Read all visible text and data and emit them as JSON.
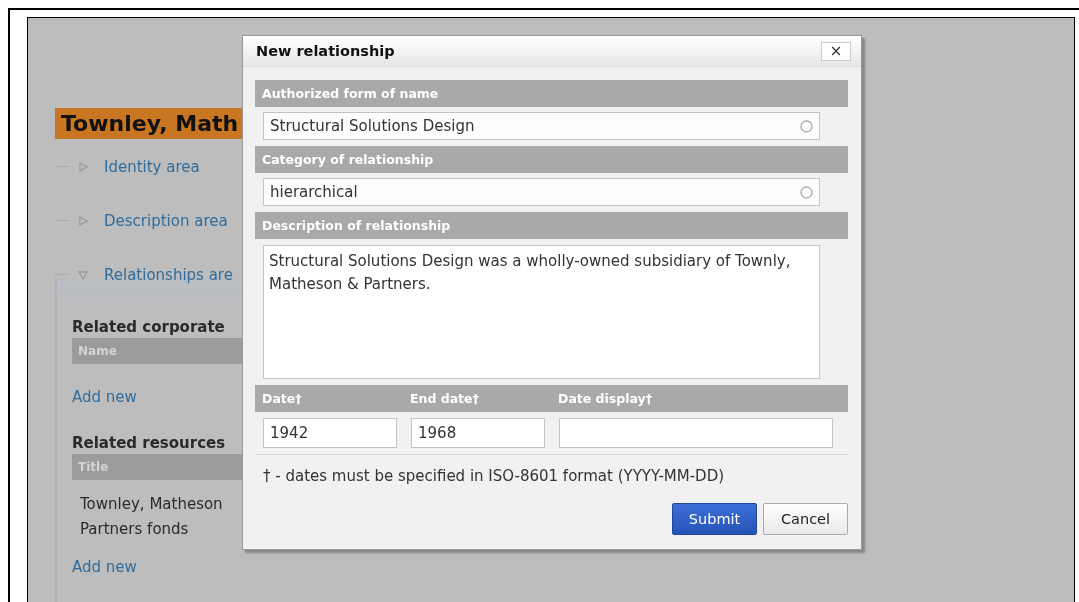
{
  "page": {
    "heading": "Townley, Math",
    "sections": [
      {
        "label": "Identity area",
        "expanded": false
      },
      {
        "label": "Description area",
        "expanded": false
      },
      {
        "label": "Relationships are",
        "expanded": true
      }
    ],
    "related_corporate_bodies": {
      "title": "Related corporate",
      "columns": [
        "Name"
      ],
      "add_link": "Add new"
    },
    "related_resources": {
      "title": "Related resources",
      "columns": [
        "Title"
      ],
      "rows": [
        [
          "Townley, Matheson\nPartners fonds"
        ]
      ],
      "add_link": "Add new"
    }
  },
  "dialog": {
    "title": "New relationship",
    "close": "×",
    "fields": [
      {
        "kind": "autocomplete",
        "label": "Authorized form of name",
        "value": "Structural Solutions Design"
      },
      {
        "kind": "autocomplete",
        "label": "Category of relationship",
        "value": "hierarchical"
      },
      {
        "kind": "textarea",
        "label": "Description of relationship",
        "value": "Structural Solutions Design was a wholly-owned subsidiary of Townly, Matheson & Partners."
      }
    ],
    "dates": [
      {
        "label": "Date†",
        "value": "1942"
      },
      {
        "label": "End date†",
        "value": "1968"
      },
      {
        "label": "Date display†"
      }
    ],
    "note": "† - dates must be specified in ISO-8601 format (YYYY-MM-DD)",
    "buttons": [
      {
        "label": "Submit",
        "primary": true
      },
      {
        "label": "Cancel",
        "primary": false
      }
    ]
  }
}
